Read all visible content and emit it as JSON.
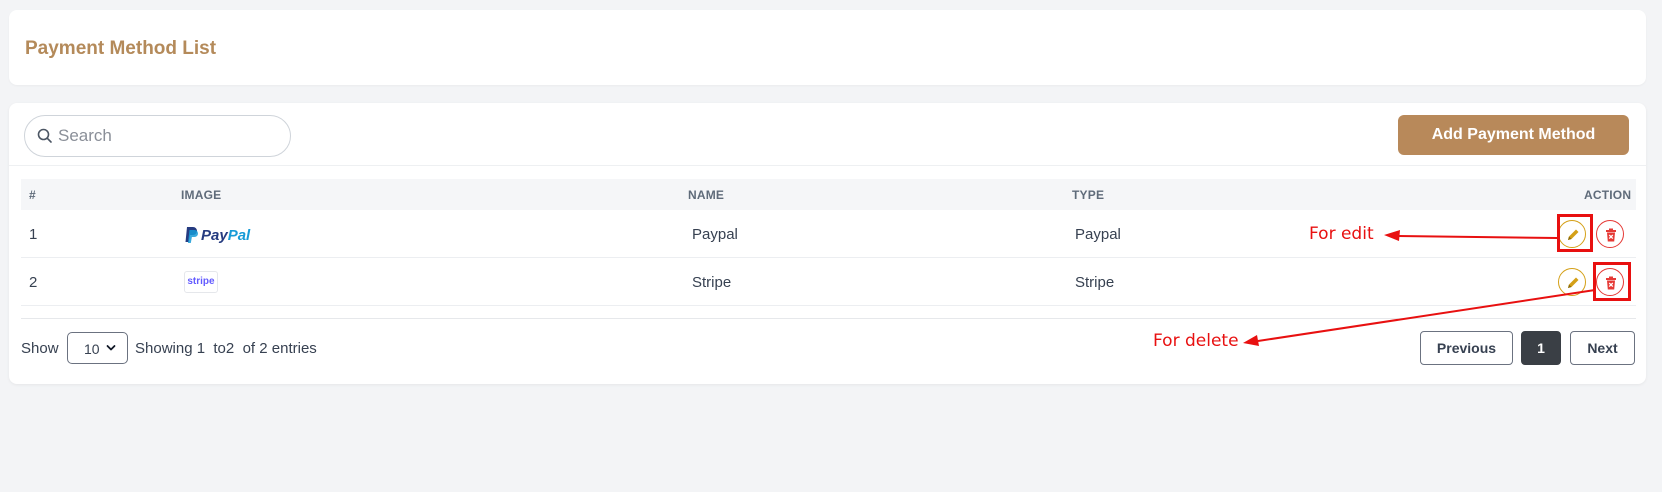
{
  "header": {
    "title": "Payment Method List"
  },
  "search": {
    "placeholder": "Search",
    "value": ""
  },
  "toolbar": {
    "add_label": "Add Payment Method"
  },
  "table": {
    "columns": {
      "num": "#",
      "image": "IMAGE",
      "name": "NAME",
      "type": "TYPE",
      "action": "ACTION"
    },
    "rows": [
      {
        "num": "1",
        "image": "paypal-logo",
        "logo_text_1": "Pay",
        "logo_text_2": "Pal",
        "name": "Paypal",
        "type": "Paypal"
      },
      {
        "num": "2",
        "image": "stripe-logo",
        "logo_text": "stripe",
        "name": "Stripe",
        "type": "Stripe"
      }
    ]
  },
  "footer": {
    "show_label": "Show",
    "page_size": "10",
    "showing_text": "Showing 1  to2  of 2 entries"
  },
  "pagination": {
    "previous": "Previous",
    "current": "1",
    "next": "Next"
  },
  "annotations": {
    "edit_label": "For edit",
    "delete_label": "For delete",
    "color": "#e81010"
  },
  "colors": {
    "accent": "#b8895a",
    "edit": "#d4a017",
    "delete": "#e53935",
    "active_page": "#3a3f45"
  }
}
